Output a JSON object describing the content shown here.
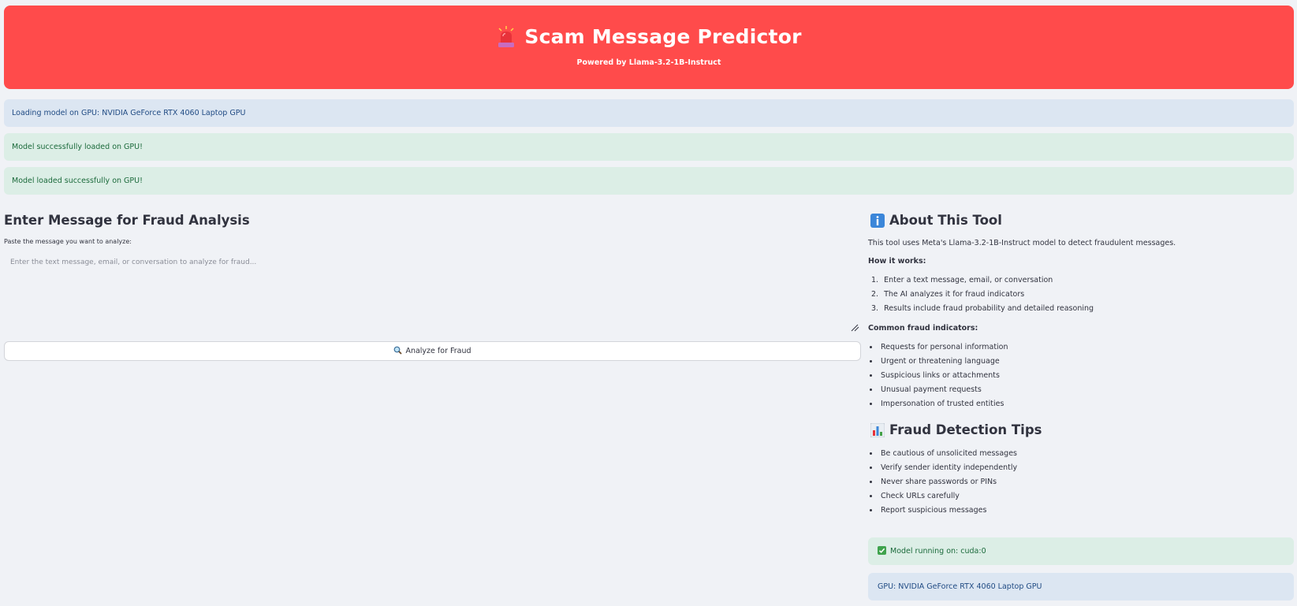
{
  "header": {
    "title": "Scam Message Predictor",
    "subtitle": "Powered by Llama-3.2-1B-Instruct",
    "icon": "siren-icon",
    "color": "#ff4b4b"
  },
  "alerts": {
    "loading": "Loading model on GPU: NVIDIA GeForce RTX 4060 Laptop GPU",
    "success1": "Model successfully loaded on GPU!",
    "success2": "Model loaded successfully on GPU!"
  },
  "analysis": {
    "heading": "Enter Message for Fraud Analysis",
    "input_label": "Paste the message you want to analyze:",
    "placeholder": "Enter the text message, email, or conversation to analyze for fraud...",
    "button_label": "Analyze for Fraud",
    "button_icon": "magnifier-icon"
  },
  "about": {
    "heading": "About This Tool",
    "icon": "info-icon",
    "description": "This tool uses Meta's Llama-3.2-1B-Instruct model to detect fraudulent messages.",
    "how_heading": "How it works:",
    "steps": [
      "Enter a text message, email, or conversation",
      "The AI analyzes it for fraud indicators",
      "Results include fraud probability and detailed reasoning"
    ],
    "indicators_heading": "Common fraud indicators:",
    "indicators": [
      "Requests for personal information",
      "Urgent or threatening language",
      "Suspicious links or attachments",
      "Unusual payment requests",
      "Impersonation of trusted entities"
    ]
  },
  "tips": {
    "heading": "Fraud Detection Tips",
    "icon": "bar-chart-icon",
    "items": [
      "Be cautious of unsolicited messages",
      "Verify sender identity independently",
      "Never share passwords or PINs",
      "Check URLs carefully",
      "Report suspicious messages"
    ]
  },
  "status": {
    "device": "Model running on: cuda:0",
    "device_icon": "check-icon",
    "gpu": "GPU: NVIDIA GeForce RTX 4060 Laptop GPU"
  }
}
